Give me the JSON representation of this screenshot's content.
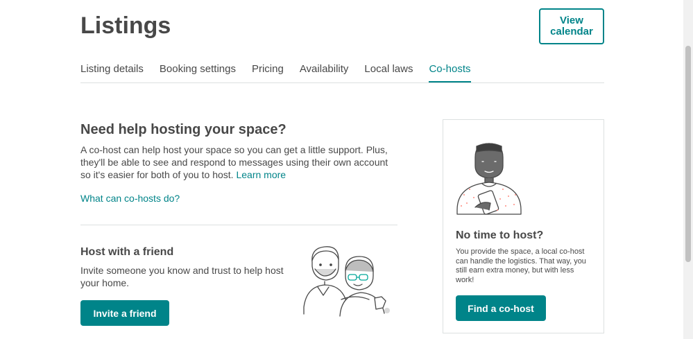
{
  "header": {
    "title": "Listings",
    "view_calendar_label": "View calendar"
  },
  "tabs": [
    {
      "label": "Listing details",
      "active": false
    },
    {
      "label": "Booking settings",
      "active": false
    },
    {
      "label": "Pricing",
      "active": false
    },
    {
      "label": "Availability",
      "active": false
    },
    {
      "label": "Local laws",
      "active": false
    },
    {
      "label": "Co-hosts",
      "active": true
    }
  ],
  "main": {
    "heading": "Need help hosting your space?",
    "description": "A co-host can help host your space so you can get a little support. Plus, they'll be able to see and respond to messages using their own account so it's easier for both of you to host.",
    "learn_more": "Learn more",
    "what_link": "What can co-hosts do?",
    "friend_heading": "Host with a friend",
    "friend_description": "Invite someone you know and trust to help host your home.",
    "invite_button": "Invite a friend"
  },
  "card": {
    "title": "No time to host?",
    "text": "You provide the space, a local co-host can handle the logistics. That way, you still earn extra money, but with less work!",
    "button": "Find a co-host"
  },
  "colors": {
    "accent": "#008489",
    "text": "#484848",
    "border": "#dce0e0"
  },
  "icons": {
    "friends_illustration": "two-people-hugging-illustration",
    "host_illustration": "person-holding-phone-illustration"
  }
}
